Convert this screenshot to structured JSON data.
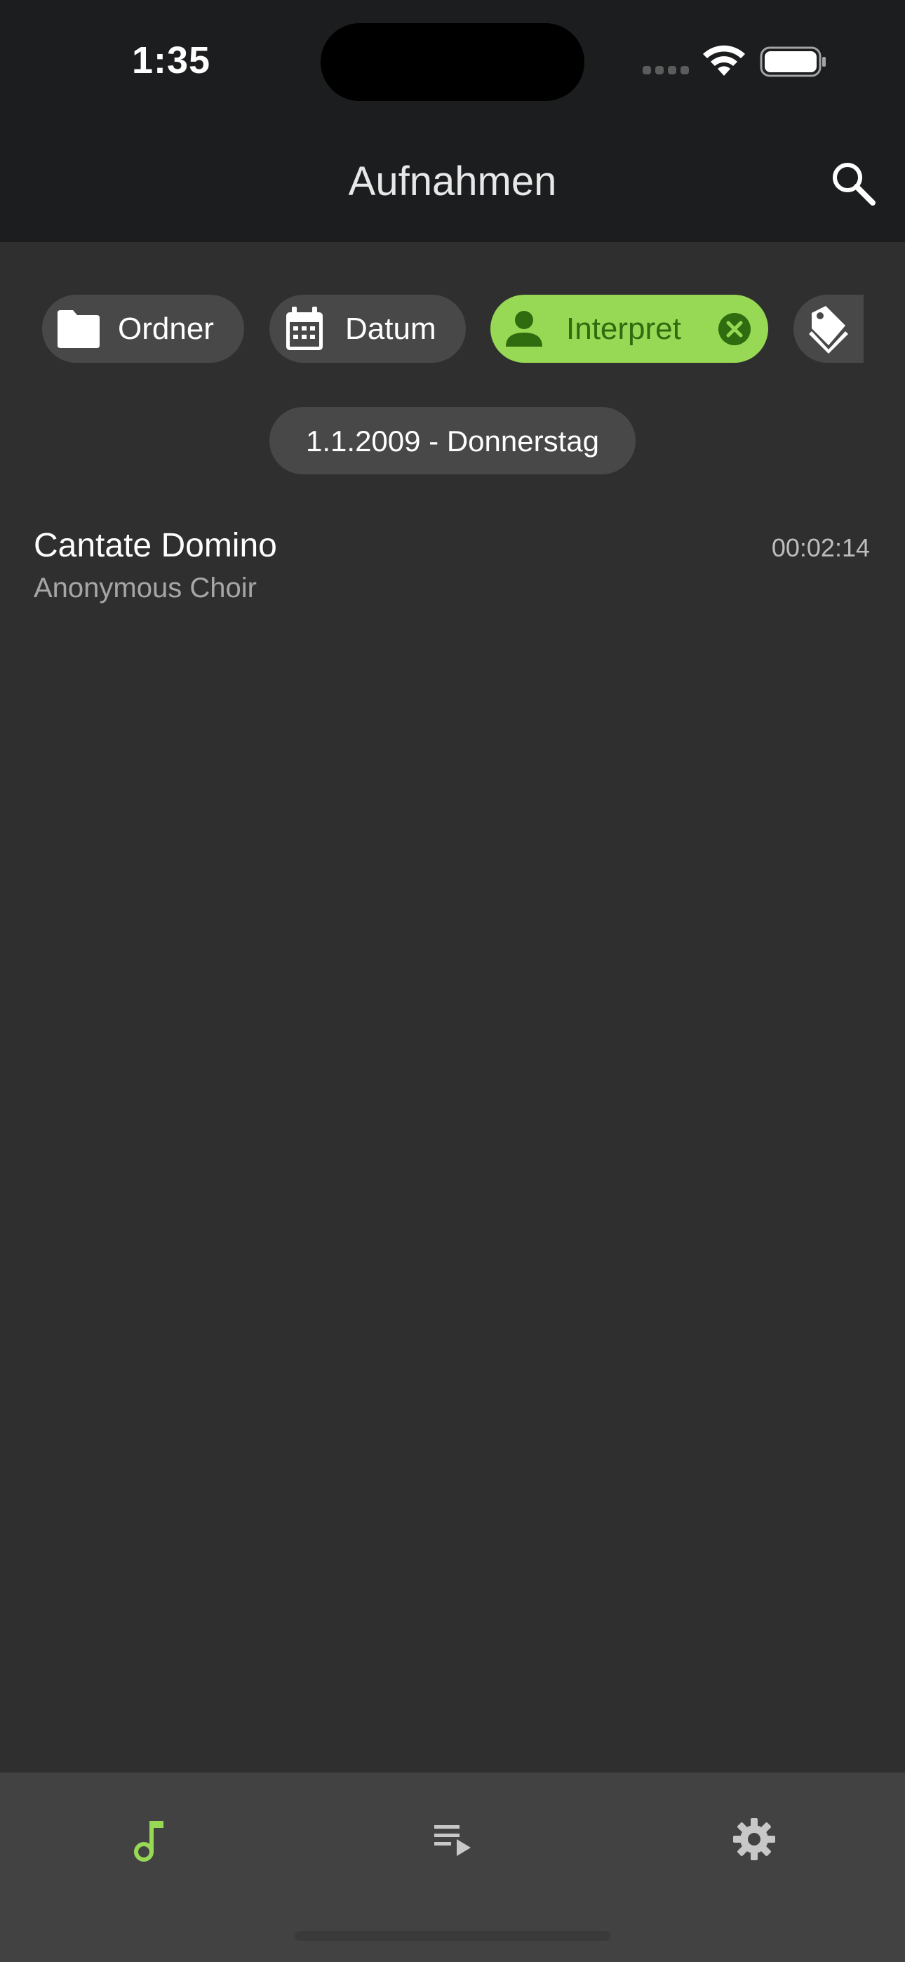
{
  "status_bar": {
    "time": "1:35",
    "icons": [
      "signal-icon",
      "wifi-icon",
      "battery-icon"
    ]
  },
  "app_bar": {
    "title": "Aufnahmen",
    "search_icon": "search-icon"
  },
  "filter_chips": [
    {
      "label": "Ordner",
      "icon": "folder-icon",
      "selected": false
    },
    {
      "label": "Datum",
      "icon": "calendar-icon",
      "selected": false
    },
    {
      "label": "Interpret",
      "icon": "person-icon",
      "selected": true,
      "clear_icon": "clear-icon"
    },
    {
      "label": "",
      "icon": "tags-icon",
      "selected": false
    }
  ],
  "date_header": "1.1.2009 - Donnerstag",
  "recordings": [
    {
      "title": "Cantate Domino",
      "artist": "Anonymous Choir",
      "duration": "00:02:14"
    }
  ],
  "bottom_nav": [
    {
      "icon": "music-note-icon",
      "active": true
    },
    {
      "icon": "playlist-icon",
      "active": false
    },
    {
      "icon": "settings-gear-icon",
      "active": false
    }
  ],
  "colors": {
    "accent": "#97d954",
    "accent_text": "#2f6b0f",
    "background": "#2f2f2f",
    "app_bar": "#1b1d1e",
    "chip": "#484848",
    "nav_bar": "#424242"
  }
}
